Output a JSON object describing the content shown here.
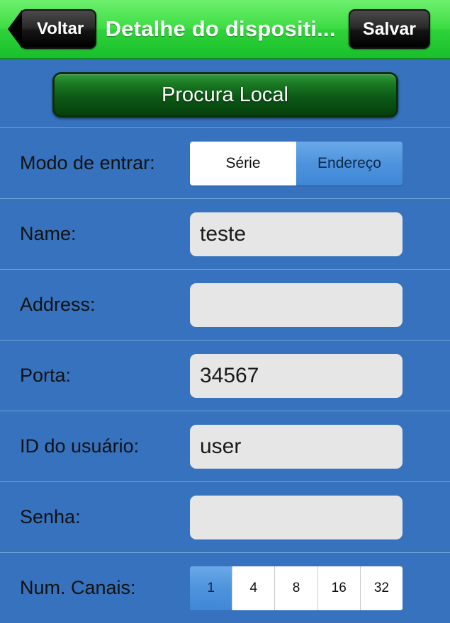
{
  "navbar": {
    "back_label": "Voltar",
    "title": "Detalhe do dispositi...",
    "save_label": "Salvar"
  },
  "search_button": {
    "label": "Procura Local"
  },
  "form": {
    "mode_row": {
      "label": "Modo de entrar:",
      "options": [
        {
          "label": "Série",
          "active": false
        },
        {
          "label": "Endereço",
          "active": true
        }
      ]
    },
    "rows": [
      {
        "label": "Name:",
        "value": "teste",
        "placeholder": ""
      },
      {
        "label": "Address:",
        "value": "",
        "placeholder": ""
      },
      {
        "label": "Porta:",
        "value": "34567",
        "placeholder": ""
      },
      {
        "label": "ID do usuário:",
        "value": "user",
        "placeholder": ""
      },
      {
        "label": "Senha:",
        "value": "",
        "placeholder": ""
      }
    ],
    "channels_row": {
      "label": "Num. Canais:",
      "options": [
        {
          "label": "1",
          "active": true
        },
        {
          "label": "4",
          "active": false
        },
        {
          "label": "8",
          "active": false
        },
        {
          "label": "16",
          "active": false
        },
        {
          "label": "32",
          "active": false
        }
      ]
    }
  },
  "colors": {
    "background": "#3672bd",
    "navbar_green": "#2fd23a",
    "field_grey": "#e6e6e6",
    "accent_blue": "#4e93dd"
  }
}
